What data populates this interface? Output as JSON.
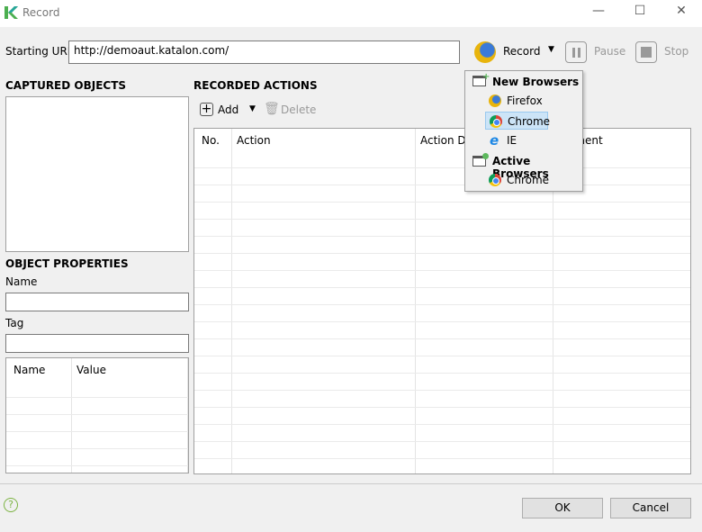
{
  "window": {
    "title": "Record",
    "minimize": "—",
    "maximize": "☐",
    "close": "✕"
  },
  "url": {
    "label": "Starting URL",
    "value": "http://demoaut.katalon.com/"
  },
  "toolbar": {
    "record": "Record",
    "pause": "Pause",
    "stop": "Stop"
  },
  "captured": {
    "title": "CAPTURED OBJECTS"
  },
  "properties": {
    "title": "OBJECT PROPERTIES",
    "name_label": "Name",
    "name_value": "",
    "tag_label": "Tag",
    "tag_value": "",
    "columns": [
      "Name",
      "Value"
    ]
  },
  "actions": {
    "title": "RECORDED ACTIONS",
    "add": "Add",
    "delete": "Delete",
    "columns": [
      "No.",
      "Action",
      "Action Data",
      "Element"
    ]
  },
  "browser_menu": {
    "new_header": "New Browsers",
    "new_items": [
      "Firefox",
      "Chrome",
      "IE"
    ],
    "selected": "Chrome",
    "active_header": "Active Browsers",
    "active_items": [
      "Chrome"
    ]
  },
  "footer": {
    "ok": "OK",
    "cancel": "Cancel",
    "help_icon": "?"
  },
  "colors": {
    "logo_green": "#7cb342",
    "selection": "#cce4f7"
  }
}
